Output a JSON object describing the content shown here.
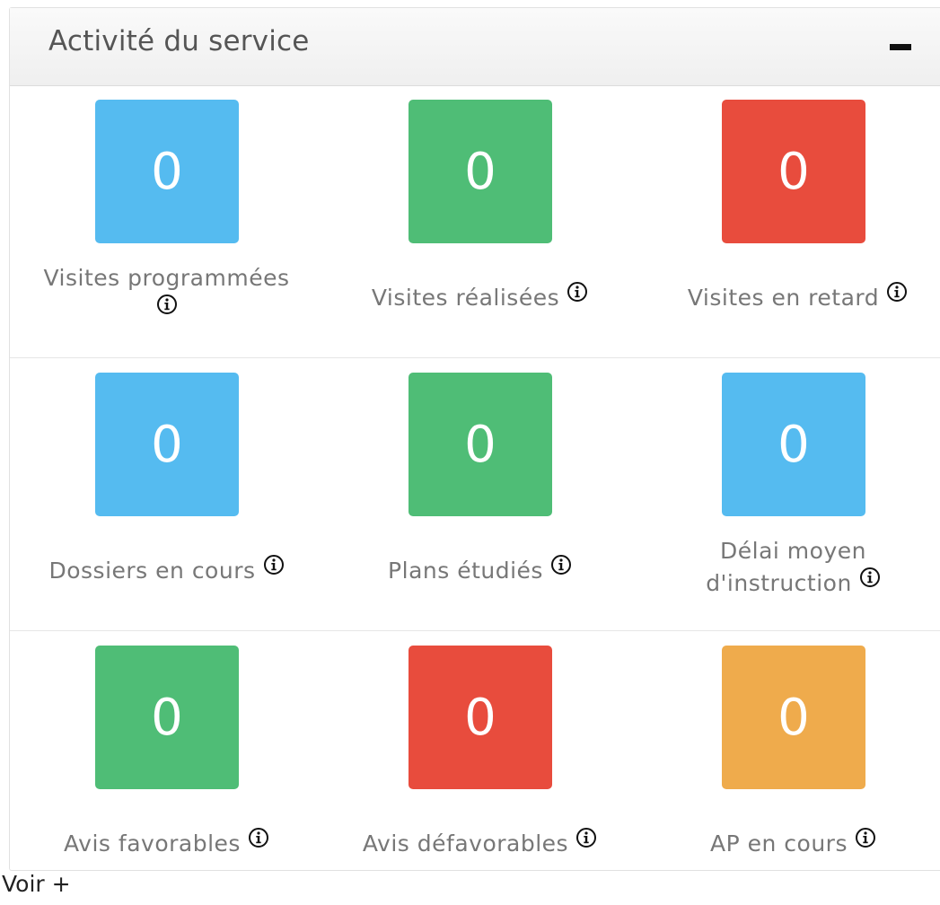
{
  "panel": {
    "title": "Activité du service",
    "collapse_icon": "minus-icon"
  },
  "colors": {
    "blue": "#55bbf0",
    "green": "#4fbd76",
    "red": "#e84c3d",
    "orange": "#efab4c"
  },
  "tiles": [
    {
      "value": "0",
      "label": "Visites programmées",
      "color": "#55bbf0",
      "icon": "info-icon"
    },
    {
      "value": "0",
      "label": "Visites réalisées",
      "color": "#4fbd76",
      "icon": "info-icon"
    },
    {
      "value": "0",
      "label": "Visites en retard",
      "color": "#e84c3d",
      "icon": "info-icon"
    },
    {
      "value": "0",
      "label": "Dossiers en cours",
      "color": "#55bbf0",
      "icon": "info-icon"
    },
    {
      "value": "0",
      "label": "Plans étudiés",
      "color": "#4fbd76",
      "icon": "info-icon"
    },
    {
      "value": "0",
      "label": "Délai moyen d'instruction",
      "color": "#55bbf0",
      "icon": "info-icon"
    },
    {
      "value": "0",
      "label": "Avis favorables",
      "color": "#4fbd76",
      "icon": "info-icon"
    },
    {
      "value": "0",
      "label": "Avis défavorables",
      "color": "#e84c3d",
      "icon": "info-icon"
    },
    {
      "value": "0",
      "label": "AP en cours",
      "color": "#efab4c",
      "icon": "info-icon"
    }
  ],
  "footer": {
    "more_link": "Voir +"
  }
}
